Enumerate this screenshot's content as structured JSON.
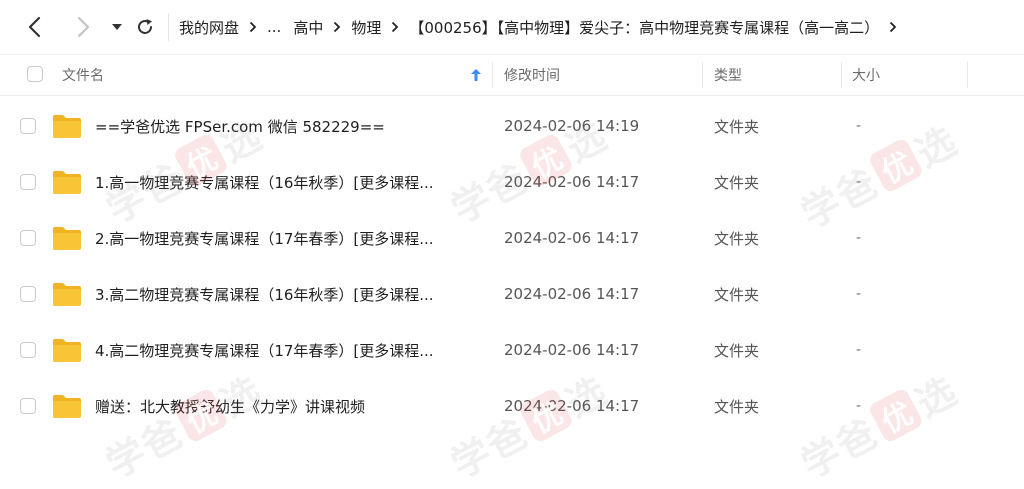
{
  "breadcrumb": [
    "我的网盘",
    "...",
    "高中",
    "物理",
    "【000256】【高中物理】爱尖子：高中物理竞赛专属课程（高一高二）"
  ],
  "columns": {
    "name": "文件名",
    "modified": "修改时间",
    "type": "类型",
    "size": "大小"
  },
  "files": [
    {
      "name": "==学爸优选 FPSer.com 微信 582229==",
      "modified": "2024-02-06 14:19",
      "type": "文件夹",
      "size": "-"
    },
    {
      "name": "1.高一物理竞赛专属课程（16年秋季）[更多课程...",
      "modified": "2024-02-06 14:17",
      "type": "文件夹",
      "size": "-"
    },
    {
      "name": "2.高一物理竞赛专属课程（17年春季）[更多课程...",
      "modified": "2024-02-06 14:17",
      "type": "文件夹",
      "size": "-"
    },
    {
      "name": "3.高二物理竞赛专属课程（16年秋季）[更多课程...",
      "modified": "2024-02-06 14:17",
      "type": "文件夹",
      "size": "-"
    },
    {
      "name": "4.高二物理竞赛专属课程（17年春季）[更多课程...",
      "modified": "2024-02-06 14:17",
      "type": "文件夹",
      "size": "-"
    },
    {
      "name": "赠送：北大教授舒幼生《力学》讲课视频",
      "modified": "2024-02-06 14:17",
      "type": "文件夹",
      "size": "-"
    }
  ],
  "watermark": {
    "part1": "学爸",
    "badge": "优",
    "part2": "选"
  },
  "colors": {
    "folder": "#F8C536",
    "folder_back": "#F0B323",
    "sort_arrow": "#3d8df5",
    "watermark_badge": "#dc3c3c"
  },
  "icons": [
    "back-arrow-icon",
    "forward-arrow-icon",
    "dropdown-icon",
    "refresh-icon",
    "chevron-right-icon",
    "sort-up-icon",
    "folder-icon"
  ]
}
